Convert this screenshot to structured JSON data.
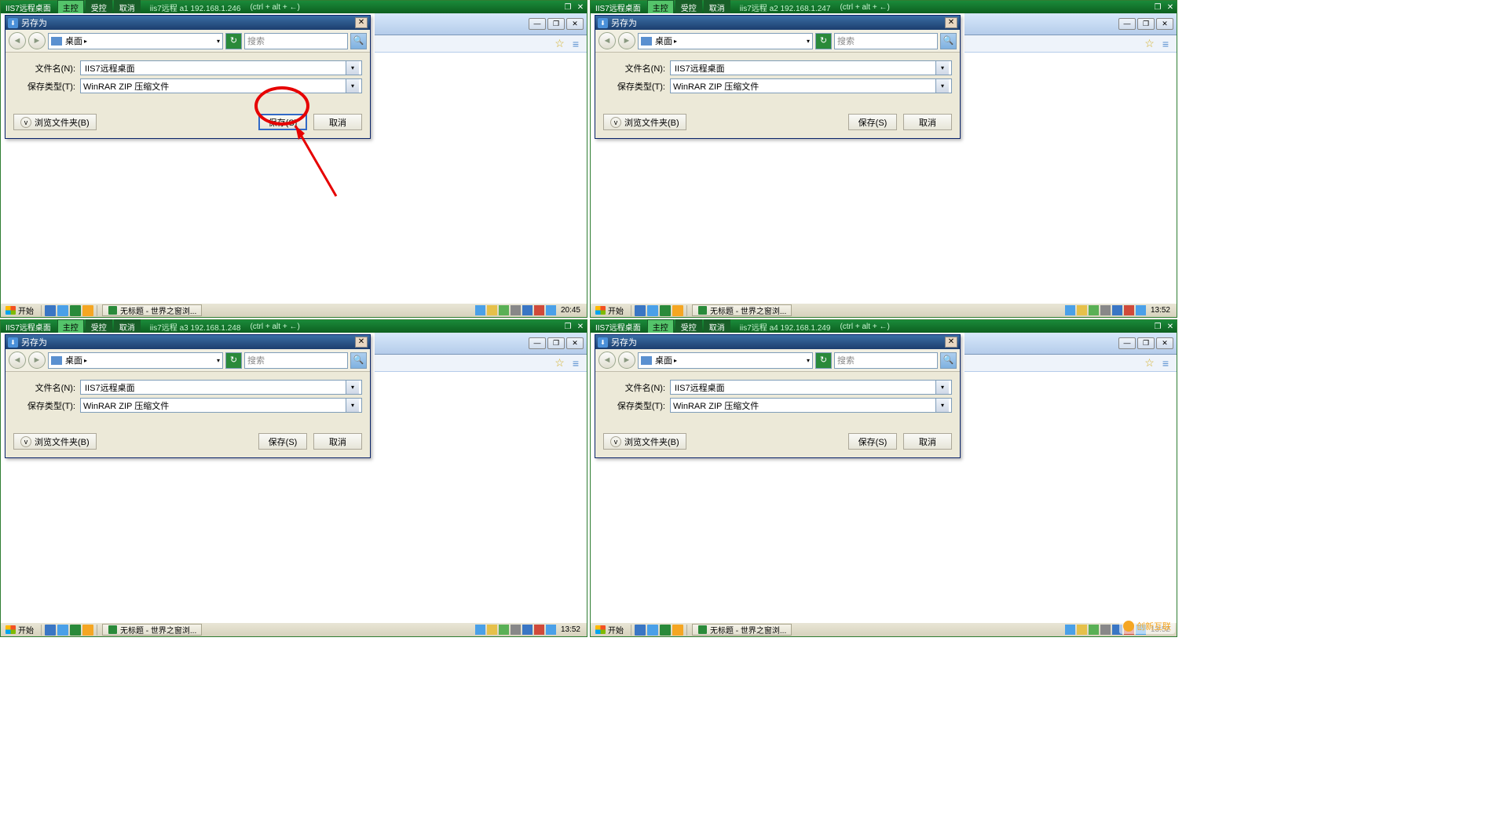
{
  "remote_tabs": {
    "app_title": "IIS7远程桌面",
    "main_ctrl": "主控",
    "sub_ctrl": "受控",
    "cancel": "取消",
    "shortcut": "(ctrl + alt + ←)",
    "sessions": [
      {
        "name": "iis7远程",
        "id": "a1",
        "ip": "192.168.1.246"
      },
      {
        "name": "iis7远程",
        "id": "a2",
        "ip": "192.168.1.247"
      },
      {
        "name": "iis7远程",
        "id": "a3",
        "ip": "192.168.1.248"
      },
      {
        "name": "iis7远程",
        "id": "a4",
        "ip": "192.168.1.249"
      }
    ]
  },
  "dialog": {
    "title": "另存为",
    "location": "桌面",
    "search_placeholder": "搜索",
    "filename_label": "文件名(N):",
    "filename_value": "IIS7远程桌面",
    "filetype_label": "保存类型(T):",
    "filetype_value": "WinRAR ZIP 压缩文件",
    "browse_folders": "浏览文件夹(B)",
    "save_btn": "保存(S)",
    "cancel_btn": "取消"
  },
  "taskbar": {
    "start": "开始",
    "task_title": "无标题 - 世界之窗浏...",
    "time_a1": "20:45",
    "time_other": "13:52"
  },
  "watermark": "创新互联"
}
